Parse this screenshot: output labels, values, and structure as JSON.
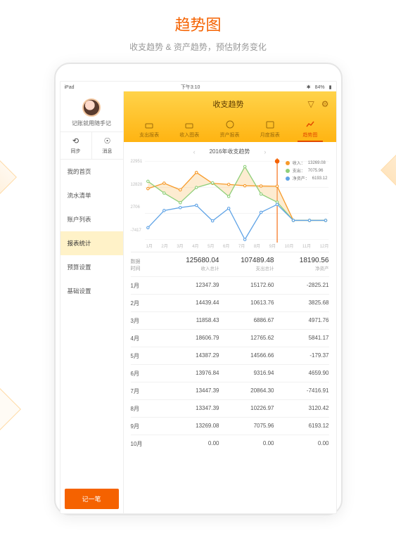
{
  "page_title": "趋势图",
  "page_subtitle": "收支趋势 & 资产趋势，预估财务变化",
  "statusbar": {
    "device": "iPad",
    "wifi": "􀙇",
    "time": "下午3:10",
    "bt": "􀋒",
    "battery": "84%"
  },
  "sidebar": {
    "profile_name": "记账就用随手记",
    "quick": {
      "sync": "同步",
      "msg": "消息"
    },
    "items": [
      "我的首页",
      "流水清单",
      "账户列表",
      "报表统计",
      "预算设置",
      "基础设置"
    ],
    "active_index": 3,
    "record_btn": "记一笔"
  },
  "header": {
    "title": "收支趋势",
    "tabs": [
      "支出报表",
      "收入图表",
      "资产报表",
      "月度报表",
      "趋势图"
    ],
    "active_tab": 4
  },
  "chart": {
    "title": "2016年收支趋势",
    "legend": [
      {
        "label": "收入：",
        "value": "13269.08"
      },
      {
        "label": "支出：",
        "value": "7075.96"
      },
      {
        "label": "净资产：",
        "value": "6193.12"
      }
    ]
  },
  "chart_data": {
    "type": "line",
    "categories": [
      "1月",
      "2月",
      "3月",
      "4月",
      "5月",
      "6月",
      "7月",
      "8月",
      "9月",
      "10月",
      "11月",
      "12月"
    ],
    "yticks": [
      "22951",
      "12828",
      "2706",
      "-7417"
    ],
    "highlight_index": 8,
    "series": [
      {
        "name": "收入",
        "color": "#f79a2a",
        "values": [
          12347.39,
          14439.44,
          11858.43,
          18606.79,
          14387.29,
          13976.84,
          13447.39,
          13347.39,
          13269.08,
          0,
          0,
          0
        ]
      },
      {
        "name": "支出",
        "color": "#8fcf7a",
        "values": [
          15172.6,
          10613.76,
          6886.67,
          12765.62,
          14566.66,
          9316.94,
          20864.3,
          10226.97,
          7075.96,
          0,
          0,
          0
        ]
      },
      {
        "name": "净资产",
        "color": "#5fa3e6",
        "values": [
          -2825.21,
          3825.68,
          4971.76,
          5841.17,
          -179.37,
          4659.9,
          -7416.91,
          3120.42,
          6193.12,
          0,
          0,
          0
        ]
      }
    ]
  },
  "table": {
    "header0_a": "数据",
    "header0_b": "时间",
    "cols": [
      {
        "big": "125680.04",
        "sm": "收入总计"
      },
      {
        "big": "107489.48",
        "sm": "支出总计"
      },
      {
        "big": "18190.56",
        "sm": "净资产"
      }
    ],
    "rows": [
      {
        "m": "1月",
        "a": "12347.39",
        "b": "15172.60",
        "c": "-2825.21"
      },
      {
        "m": "2月",
        "a": "14439.44",
        "b": "10613.76",
        "c": "3825.68"
      },
      {
        "m": "3月",
        "a": "11858.43",
        "b": "6886.67",
        "c": "4971.76"
      },
      {
        "m": "4月",
        "a": "18606.79",
        "b": "12765.62",
        "c": "5841.17"
      },
      {
        "m": "5月",
        "a": "14387.29",
        "b": "14566.66",
        "c": "-179.37"
      },
      {
        "m": "6月",
        "a": "13976.84",
        "b": "9316.94",
        "c": "4659.90"
      },
      {
        "m": "7月",
        "a": "13447.39",
        "b": "20864.30",
        "c": "-7416.91"
      },
      {
        "m": "8月",
        "a": "13347.39",
        "b": "10226.97",
        "c": "3120.42"
      },
      {
        "m": "9月",
        "a": "13269.08",
        "b": "7075.96",
        "c": "6193.12"
      },
      {
        "m": "10月",
        "a": "0.00",
        "b": "0.00",
        "c": "0.00"
      }
    ]
  }
}
